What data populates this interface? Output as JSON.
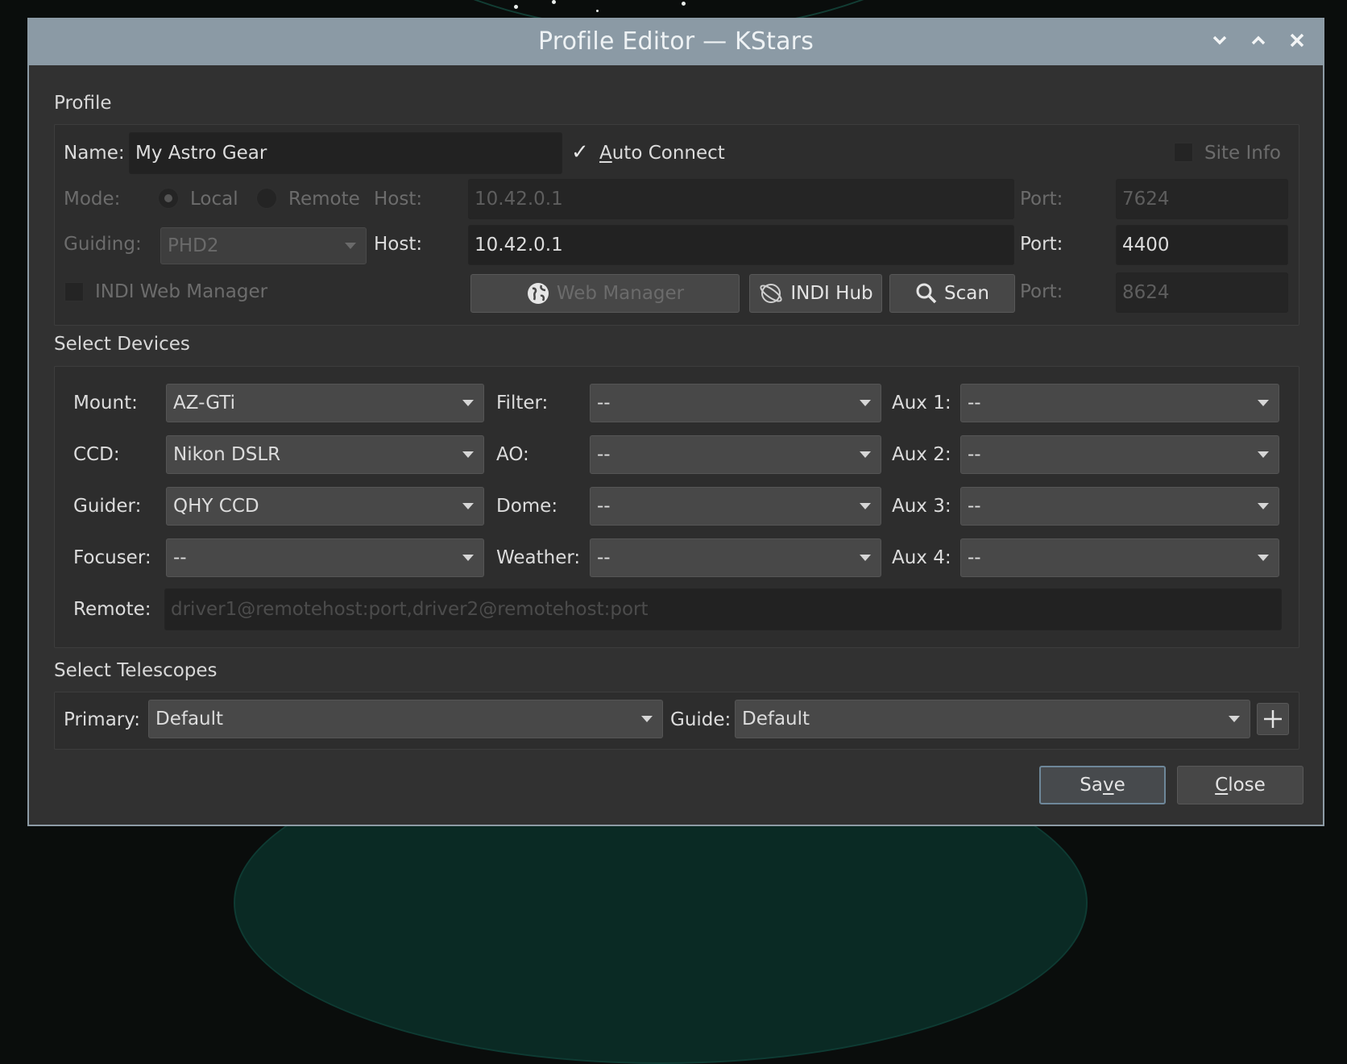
{
  "window": {
    "title": "Profile Editor — KStars",
    "minimize_icon": "chevron-down-icon",
    "maximize_icon": "chevron-up-icon",
    "close_icon": "close-icon"
  },
  "profile": {
    "section_label": "Profile",
    "name_label": "Name:",
    "name_value": "My Astro Gear",
    "auto_connect_label": "Auto Connect",
    "auto_connect_checked": true,
    "site_info_label": "Site Info",
    "mode_label": "Mode:",
    "mode_local": "Local",
    "mode_remote": "Remote",
    "host_label": "Host:",
    "host_value": "10.42.0.1",
    "port_label": "Port:",
    "port_value": "7624",
    "guiding_label": "Guiding:",
    "guiding_value": "PHD2",
    "guide_host_label": "Host:",
    "guide_host_value": "10.42.0.1",
    "guide_port_label": "Port:",
    "guide_port_value": "4400",
    "indi_web_manager_label": "INDI Web Manager",
    "web_manager_button": "Web Manager",
    "indi_hub_button": "INDI Hub",
    "scan_button": "Scan",
    "web_port_label": "Port:",
    "web_port_value": "8624"
  },
  "devices": {
    "section_label": "Select Devices",
    "mount_label": "Mount:",
    "mount_value": "AZ-GTi",
    "ccd_label": "CCD:",
    "ccd_value": "Nikon DSLR",
    "guider_label": "Guider:",
    "guider_value": "QHY CCD",
    "focuser_label": "Focuser:",
    "focuser_value": "--",
    "filter_label": "Filter:",
    "filter_value": "--",
    "ao_label": "AO:",
    "ao_value": "--",
    "dome_label": "Dome:",
    "dome_value": "--",
    "weather_label": "Weather:",
    "weather_value": "--",
    "aux1_label": "Aux 1:",
    "aux1_value": "--",
    "aux2_label": "Aux 2:",
    "aux2_value": "--",
    "aux3_label": "Aux 3:",
    "aux3_value": "--",
    "aux4_label": "Aux 4:",
    "aux4_value": "--",
    "remote_label": "Remote:",
    "remote_placeholder": "driver1@remotehost:port,driver2@remotehost:port"
  },
  "telescopes": {
    "section_label": "Select Telescopes",
    "primary_label": "Primary:",
    "primary_value": "Default",
    "guide_label": "Guide:",
    "guide_value": "Default",
    "add_icon": "plus-icon"
  },
  "footer": {
    "save_label": "Save",
    "close_label": "Close"
  }
}
